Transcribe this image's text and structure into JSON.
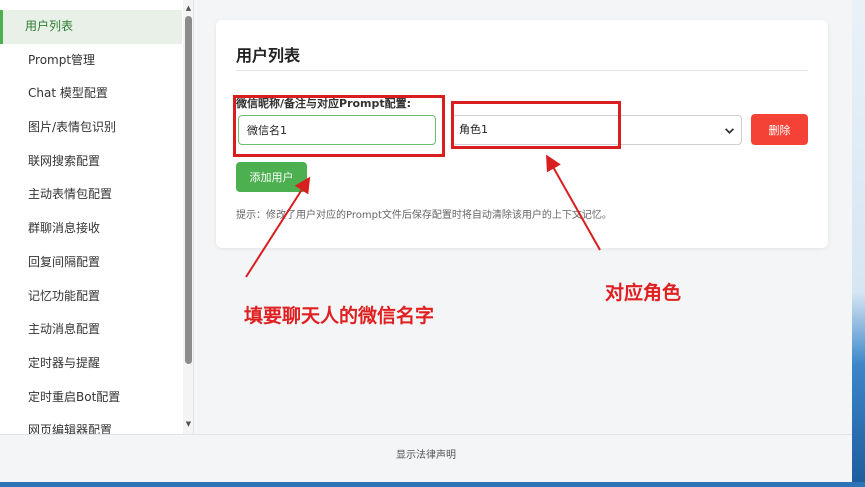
{
  "sidebar": {
    "items": [
      {
        "label": "用户列表",
        "active": true
      },
      {
        "label": "Prompt管理"
      },
      {
        "label": "Chat 模型配置"
      },
      {
        "label": "图片/表情包识别"
      },
      {
        "label": "联网搜索配置"
      },
      {
        "label": "主动表情包配置"
      },
      {
        "label": "群聊消息接收"
      },
      {
        "label": "回复间隔配置"
      },
      {
        "label": "记忆功能配置"
      },
      {
        "label": "主动消息配置"
      },
      {
        "label": "定时器与提醒"
      },
      {
        "label": "定时重启Bot配置"
      },
      {
        "label": "网页编辑器配置"
      }
    ]
  },
  "main": {
    "title": "用户列表",
    "field_label": "微信昵称/备注与对应Prompt配置:",
    "name_input_value": "微信名1",
    "role_select_value": "角色1",
    "delete_label": "删除",
    "add_user_label": "添加用户",
    "hint": "提示：修改了用户对应的Prompt文件后保存配置时将自动清除该用户的上下文记忆。"
  },
  "annotations": {
    "name_note": "填要聊天人的微信名字",
    "role_note": "对应角色"
  },
  "footer": {
    "legal_link": "显示法律声明"
  },
  "colors": {
    "accent_green": "#4caf50",
    "danger_red": "#f44336",
    "annotation_red": "#d81e1e"
  }
}
